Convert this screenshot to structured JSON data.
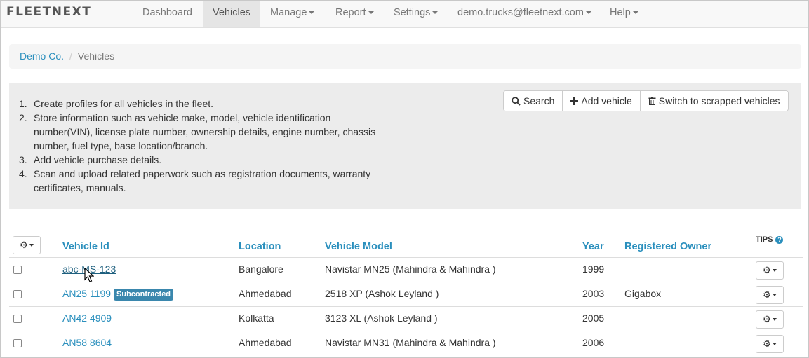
{
  "nav": {
    "brand": "FLEETNEXT",
    "items": [
      {
        "label": "Dashboard",
        "active": false,
        "dropdown": false
      },
      {
        "label": "Vehicles",
        "active": true,
        "dropdown": false
      },
      {
        "label": "Manage",
        "active": false,
        "dropdown": true
      },
      {
        "label": "Report",
        "active": false,
        "dropdown": true
      },
      {
        "label": "Settings",
        "active": false,
        "dropdown": true
      },
      {
        "label": "demo.trucks@fleetnext.com",
        "active": false,
        "dropdown": true
      },
      {
        "label": "Help",
        "active": false,
        "dropdown": true
      }
    ]
  },
  "breadcrumb": {
    "root": "Demo Co.",
    "separator": "/",
    "current": "Vehicles"
  },
  "info": {
    "steps": [
      "Create profiles for all vehicles in the fleet.",
      "Store information such as vehicle make, model, vehicle identification number(VIN), license plate number, ownership details, engine number, chassis number, fuel type, base location/branch.",
      "Add vehicle purchase details.",
      "Scan and upload related paperwork such as registration documents, warranty certificates, manuals."
    ],
    "numbers": [
      "1.",
      "2.",
      "3.",
      "4."
    ],
    "buttons": {
      "search": "Search",
      "add": "Add vehicle",
      "scrapped": "Switch to scrapped vehicles"
    }
  },
  "table": {
    "columns": {
      "vehicle_id": "Vehicle Id",
      "location": "Location",
      "model": "Vehicle Model",
      "year": "Year",
      "owner": "Registered Owner",
      "tips": "TIPS"
    },
    "rows": [
      {
        "vehicle_id": "abc-MS-123",
        "badge": "",
        "location": "Bangalore",
        "model": "Navistar MN25 (Mahindra & Mahindra )",
        "year": "1999",
        "owner": ""
      },
      {
        "vehicle_id": "AN25 1199",
        "badge": "Subcontracted",
        "location": "Ahmedabad",
        "model": "2518 XP (Ashok Leyland )",
        "year": "2003",
        "owner": "Gigabox"
      },
      {
        "vehicle_id": "AN42 4909",
        "badge": "",
        "location": "Kolkatta",
        "model": "3123 XL (Ashok Leyland )",
        "year": "2005",
        "owner": ""
      },
      {
        "vehicle_id": "AN58 8604",
        "badge": "",
        "location": "Ahmedabad",
        "model": "Navistar MN31 (Mahindra & Mahindra )",
        "year": "2006",
        "owner": ""
      }
    ]
  },
  "colors": {
    "link": "#2a8fbd",
    "badge": "#3a87ad",
    "panel": "#ececec"
  }
}
